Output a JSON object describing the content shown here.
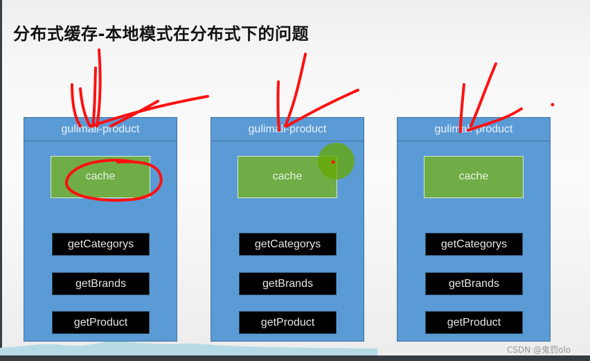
{
  "slide": {
    "title": "分布式缓存-本地模式在分布式下的问题"
  },
  "nodes": [
    {
      "name": "gulimall-product",
      "cache_label": "cache",
      "methods": [
        "getCategorys",
        "getBrands",
        "getProduct"
      ]
    },
    {
      "name": "gulimall-product",
      "cache_label": "cache",
      "methods": [
        "getCategorys",
        "getBrands",
        "getProduct"
      ]
    },
    {
      "name": "gulimall-product",
      "cache_label": "cache",
      "methods": [
        "getCategorys",
        "getBrands",
        "getProduct"
      ]
    }
  ],
  "annotations": {
    "description": "Red hand-drawn arrows pointing down to each node; red circle around first cache",
    "color": "#ff0000",
    "pointer_color": "#66aa00"
  },
  "colors": {
    "node_fill": "#5b9bd5",
    "cache_fill": "#70ad47",
    "method_fill": "#000000"
  },
  "watermark": "CSDN @鬼罚olo"
}
